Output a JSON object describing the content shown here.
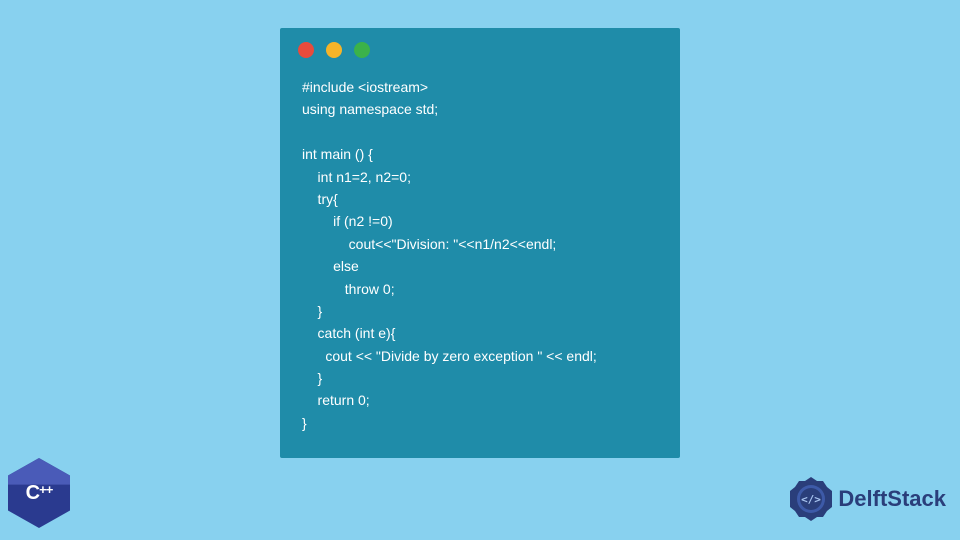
{
  "colors": {
    "page_bg": "#88d1ef",
    "window_bg": "#1f8ca9",
    "code_fg": "#ffffff",
    "dot_red": "#e94b3c",
    "dot_yellow": "#f5b429",
    "dot_green": "#3bb24a",
    "cpp_hex_dark": "#2a3a8f",
    "cpp_hex_light": "#4a5bb8",
    "delft_color": "#2a3e7a"
  },
  "code": {
    "content": "#include <iostream>\nusing namespace std;\n\nint main () {\n    int n1=2, n2=0;\n    try{\n        if (n2 !=0)\n            cout<<\"Division: \"<<n1/n2<<endl;\n        else\n           throw 0;\n    }\n    catch (int e){\n      cout << \"Divide by zero exception \" << endl;\n    }\n    return 0;\n}"
  },
  "logos": {
    "cpp_label": "C",
    "cpp_plusplus": "++",
    "delft_text": "DelftStack"
  }
}
